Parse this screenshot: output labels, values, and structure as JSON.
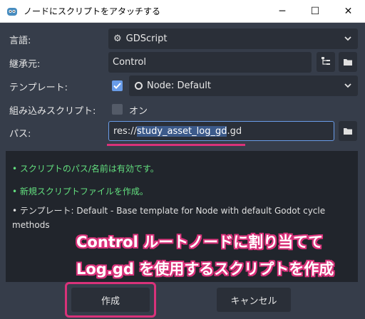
{
  "window": {
    "title": "ノードにスクリプトをアタッチする",
    "minimize": "─",
    "maximize": "☐",
    "close": "✕"
  },
  "form": {
    "language": {
      "label": "言語:",
      "value": "GDScript"
    },
    "inherits": {
      "label": "継承元:",
      "value": "Control"
    },
    "template": {
      "label": "テンプレート:",
      "value": "Node: Default",
      "checked": true
    },
    "builtin": {
      "label": "組み込みスクリプト:",
      "toggle_label": "オン",
      "checked": false
    },
    "path": {
      "label": "パス:",
      "prefix": "res://",
      "selected": "study_asset_log_gd",
      "suffix": ".gd"
    }
  },
  "info": {
    "line1": "•  スクリプトのパス/名前は有効です。",
    "line2": "•  新規スクリプトファイルを作成。",
    "line3": "•  テンプレート: Default - Base template for Node with default Godot cycle methods"
  },
  "annotation": {
    "line1": "Control ルートノードに割り当てて",
    "line2": "Log.gd を使用するスクリプトを作成"
  },
  "buttons": {
    "create": "作成",
    "cancel": "キャンセル"
  },
  "colors": {
    "background": "#363d4a",
    "field": "#2a2f38",
    "accent": "#699ce8",
    "success": "#63e07f",
    "highlight": "#d9327a"
  }
}
